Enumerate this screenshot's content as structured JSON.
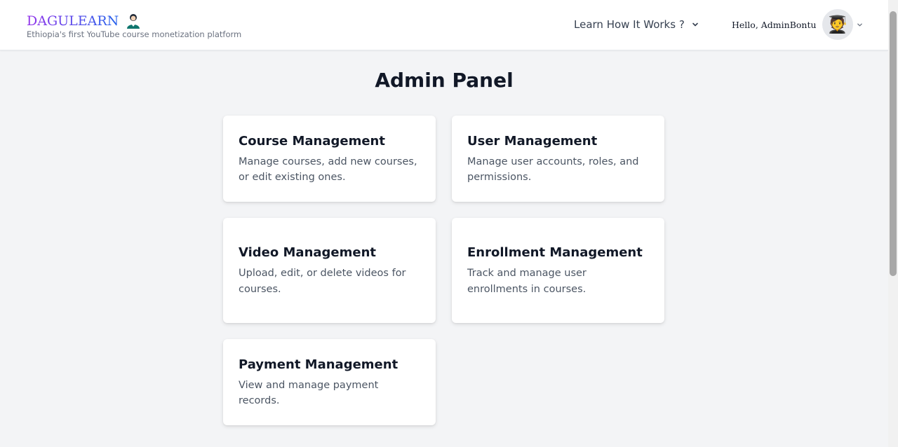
{
  "header": {
    "brand_name": "DAGULEARN",
    "tagline": "Ethiopia's first YouTube course monetization platform",
    "learn_menu_label": "Learn How It Works ?",
    "greeting": "Hello, AdminBontu",
    "avatar_emoji": "🧑‍🎓"
  },
  "main": {
    "title": "Admin Panel",
    "cards": [
      {
        "title": "Course Management",
        "description": "Manage courses, add new courses, or edit existing ones."
      },
      {
        "title": "User Management",
        "description": "Manage user accounts, roles, and permissions."
      },
      {
        "title": "Video Management",
        "description": "Upload, edit, or delete videos for courses."
      },
      {
        "title": "Enrollment Management",
        "description": "Track and manage user enrollments in courses."
      },
      {
        "title": "Payment Management",
        "description": "View and manage payment records."
      }
    ]
  },
  "icons": {
    "brand": "graduate-person-icon",
    "learn_menu": "chevron-down-icon",
    "user_menu": "chevron-down-icon"
  },
  "colors": {
    "brand_gradient_start": "#9333ea",
    "brand_gradient_end": "#2563eb",
    "page_background": "#f3f4f6",
    "card_background": "#ffffff"
  }
}
